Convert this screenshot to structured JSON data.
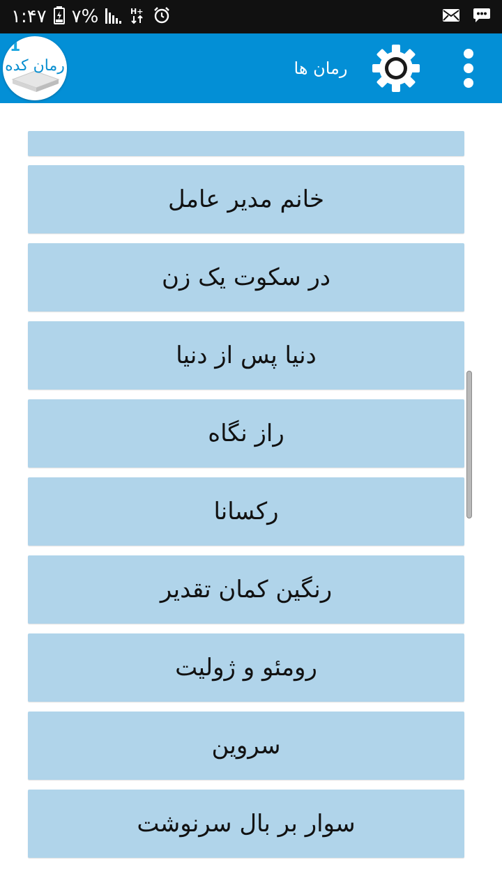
{
  "status_bar": {
    "time": "۱:۴۷",
    "battery_percent": "۷%",
    "network_type": "H+",
    "icons": [
      "battery-icon",
      "signal-icon",
      "network-h-plus-icon",
      "alarm-icon",
      "mail-icon",
      "message-icon"
    ]
  },
  "app_bar": {
    "title": "رمان ها",
    "logo_text": "رمان کده",
    "logo_badge": "1",
    "color": "#038fd6"
  },
  "list": {
    "item_color": "#b0d4ea",
    "partial_item_label": "",
    "items": [
      {
        "label": "خانم مدیر عامل"
      },
      {
        "label": "در سکوت یک زن"
      },
      {
        "label": "دنیا پس از دنیا"
      },
      {
        "label": "راز نگاه"
      },
      {
        "label": "رکسانا"
      },
      {
        "label": "رنگین کمان تقدیر"
      },
      {
        "label": "رومئو و ژولیت"
      },
      {
        "label": "سروین"
      },
      {
        "label": "سوار بر بال سرنوشت"
      }
    ]
  }
}
